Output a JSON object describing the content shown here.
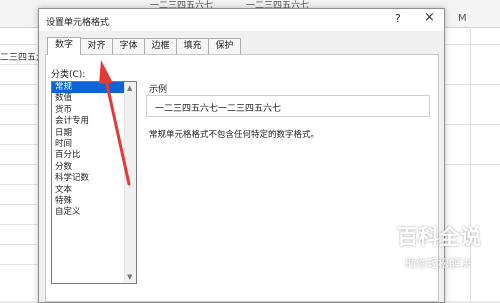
{
  "sheet": {
    "top_fragments": [
      "一二三四五六七",
      "一二三四五六七"
    ],
    "col_label": "M",
    "cell_fragment": "二三四五六"
  },
  "dialog": {
    "title": "设置单元格格式",
    "help": "?",
    "close": "×",
    "tabs": [
      "数字",
      "对齐",
      "字体",
      "边框",
      "填充",
      "保护"
    ],
    "active_tab": "数字",
    "category_label": "分类(C):",
    "categories": [
      "常规",
      "数值",
      "货币",
      "会计专用",
      "日期",
      "时间",
      "百分比",
      "分数",
      "科学记数",
      "文本",
      "特殊",
      "自定义"
    ],
    "selected_category": "常规",
    "sample_label": "示例",
    "sample_value": "一二三四五六七一二三四五六七",
    "description": "常规单元格格式不包含任何特定的数字格式。"
  },
  "watermark": {
    "title": "百科全说",
    "subtitle": "助你轻松解决"
  },
  "colors": {
    "selection": "#0a64d6",
    "arrow": "#e53935"
  }
}
